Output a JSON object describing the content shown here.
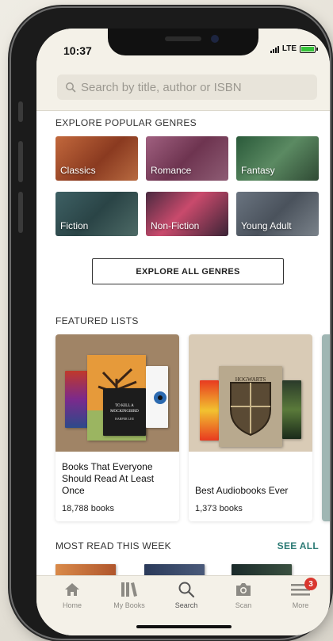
{
  "status_bar": {
    "time": "10:37",
    "network": "LTE"
  },
  "search": {
    "placeholder": "Search by title, author or ISBN"
  },
  "genres": {
    "section_title": "EXPLORE POPULAR GENRES",
    "items": [
      {
        "label": "Classics",
        "color": "#9c4a2a"
      },
      {
        "label": "Romance",
        "color": "#7a3d57"
      },
      {
        "label": "Fantasy",
        "color": "#3e6a4a"
      },
      {
        "label": "Fiction",
        "color": "#3b5a5e"
      },
      {
        "label": "Non-Fiction",
        "color": "#5e3550"
      },
      {
        "label": "Young Adult",
        "color": "#5d6670"
      }
    ],
    "explore_all_label": "EXPLORE ALL GENRES"
  },
  "featured": {
    "section_title": "FEATURED LISTS",
    "lists": [
      {
        "title": "Books That Everyone Should Read At Least Once",
        "count": "18,788 books",
        "cover_text": "TO KILL A MOCKINGBIRD",
        "cover_author": "HARPER LEE"
      },
      {
        "title": "Best Audiobooks Ever",
        "count": "1,373 books",
        "cover_text": "HOGWARTS"
      }
    ]
  },
  "most_read": {
    "section_title": "MOST READ THIS WEEK",
    "see_all_label": "SEE ALL"
  },
  "tabbar": {
    "items": [
      {
        "label": "Home"
      },
      {
        "label": "My Books"
      },
      {
        "label": "Search"
      },
      {
        "label": "Scan"
      },
      {
        "label": "More"
      }
    ],
    "more_badge": "3",
    "active_color": "#555555",
    "inactive_color": "#8c8a84"
  },
  "colors": {
    "accent": "#2b7a74",
    "app_bg": "#f4f1e8",
    "badge": "#d9372f"
  }
}
